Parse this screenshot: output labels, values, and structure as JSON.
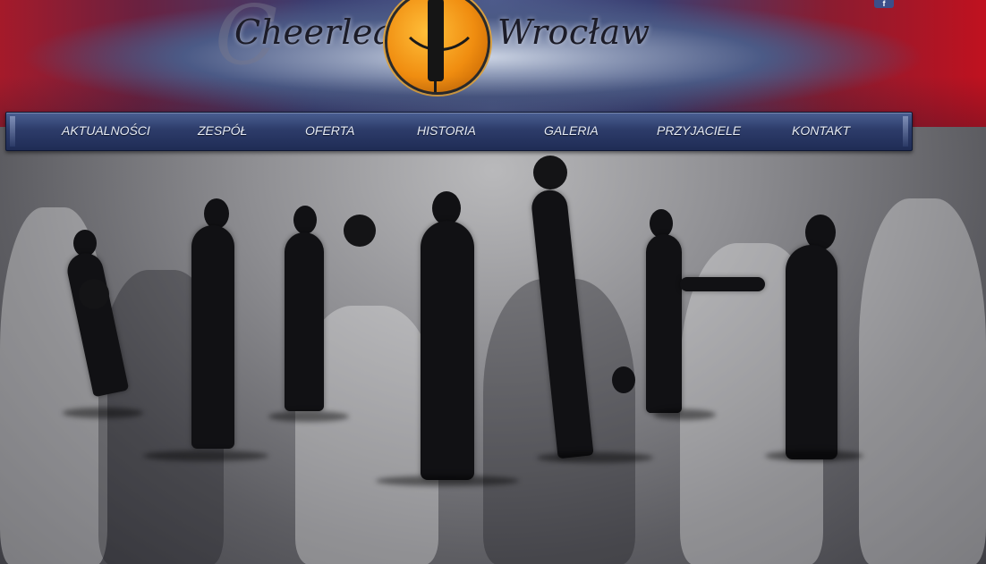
{
  "header": {
    "logo_left": "Cheerleaders",
    "logo_right": "Wrocław",
    "social_icon": "f"
  },
  "nav": {
    "items": [
      {
        "label": "AKTUALNOŚCI"
      },
      {
        "label": "ZESPÓŁ"
      },
      {
        "label": "OFERTA"
      },
      {
        "label": "HISTORIA"
      },
      {
        "label": "GALERIA"
      },
      {
        "label": "PRZYJACIELE"
      },
      {
        "label": "KONTAKT"
      }
    ]
  },
  "icons": {
    "logo": "basketball-dancer-logo-icon",
    "social": "facebook-icon"
  },
  "colors": {
    "nav_bg": "#2d3c6a",
    "nav_text": "#e6ebf5",
    "accent_red": "#c0111f",
    "ball_orange": "#f08d10"
  }
}
